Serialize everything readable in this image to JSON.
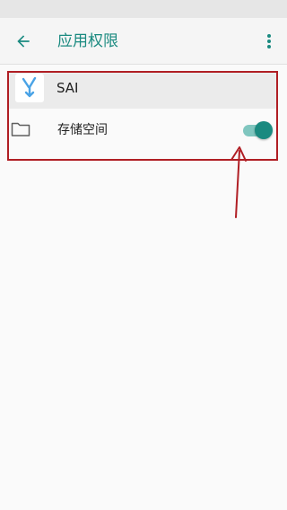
{
  "header": {
    "title": "应用权限",
    "back_icon": "arrow-left-icon",
    "more_icon": "more-vert-icon"
  },
  "app": {
    "name": "SAI",
    "icon": "sai-app-icon"
  },
  "permissions": [
    {
      "icon": "folder-icon",
      "label": "存储空间",
      "enabled": true
    }
  ],
  "colors": {
    "accent": "#1a8a80",
    "track": "#80c6bf",
    "annotation": "#b01e24"
  }
}
